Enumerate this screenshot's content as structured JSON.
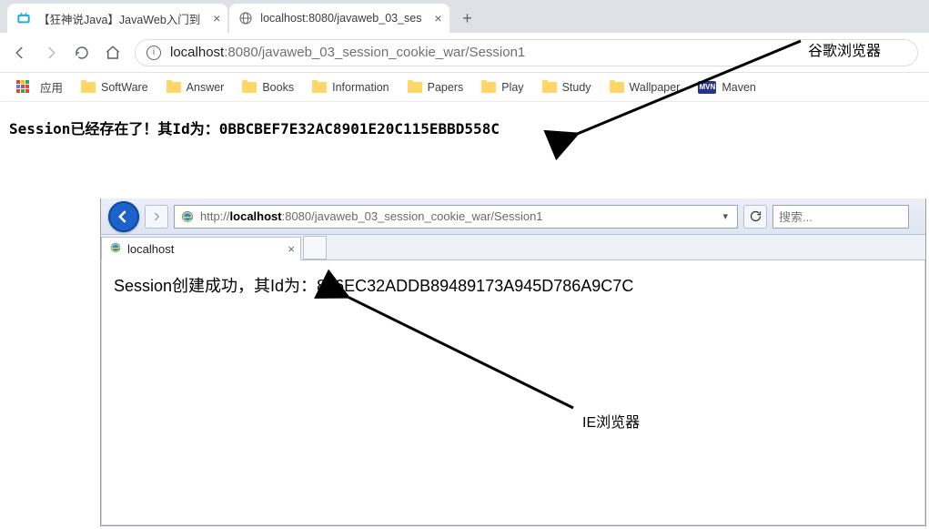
{
  "annotations": {
    "chrome_label": "谷歌浏览器",
    "ie_label": "IE浏览器"
  },
  "chrome": {
    "tabs": [
      {
        "title": "【狂神说Java】JavaWeb入门到"
      },
      {
        "title": "localhost:8080/javaweb_03_ses"
      }
    ],
    "url_host": "localhost",
    "url_port": ":8080",
    "url_path": "/javaweb_03_session_cookie_war/Session1",
    "bookmarks": {
      "apps": "应用",
      "items": [
        "SoftWare",
        "Answer",
        "Books",
        "Information",
        "Papers",
        "Play",
        "Study",
        "Wallpaper"
      ],
      "maven": "Maven"
    },
    "page_prefix": "Session已经存在了！其Id为：",
    "page_id": "0BBCBEF7E32AC8901E20C115EBBD558C"
  },
  "ie": {
    "url_prefix": "http://",
    "url_host": "localhost",
    "url_rest": ":8080/javaweb_03_session_cookie_war/Session1",
    "search_placeholder": "搜索...",
    "tab_title": "localhost",
    "page_prefix": "Session创建成功，其Id为：",
    "page_id": "896EC32ADDB89489173A945D786A9C7C"
  }
}
